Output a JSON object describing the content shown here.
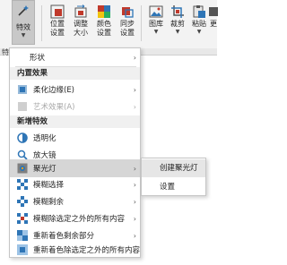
{
  "ribbon": {
    "tab_fragment": "特",
    "effects_label": "特效",
    "buttons": [
      {
        "label_1": "位置",
        "label_2": "设置"
      },
      {
        "label_1": "调整",
        "label_2": "大小"
      },
      {
        "label_1": "颜色",
        "label_2": "设置"
      },
      {
        "label_1": "同步",
        "label_2": "设置"
      },
      {
        "label_1": "图库",
        "label_2": ""
      },
      {
        "label_1": "裁剪",
        "label_2": ""
      },
      {
        "label_1": "粘贴",
        "label_2": ""
      },
      {
        "label_1": "更",
        "label_2": ""
      }
    ],
    "accent": "#c0392b"
  },
  "menu": {
    "shape_label": "形状",
    "section_builtin": "内置效果",
    "soft_edges_label": "柔化边缘(E)",
    "art_effects_label": "艺术效果(A)",
    "section_new": "新增特效",
    "transparency_label": "透明化",
    "magnifier_label": "放大镜",
    "spotlight_label": "聚光灯",
    "mosaic_select_label": "模糊选择",
    "mosaic_remain_label": "模糊剩余",
    "mosaic_except_label": "模糊除选定之外的所有内容",
    "recolor_remain_label": "重新着色剩余部分",
    "recolor_except_label": "重新着色除选定之外的所有内容"
  },
  "submenu": {
    "create_spotlight_label": "创建聚光灯",
    "settings_label": "设置"
  }
}
